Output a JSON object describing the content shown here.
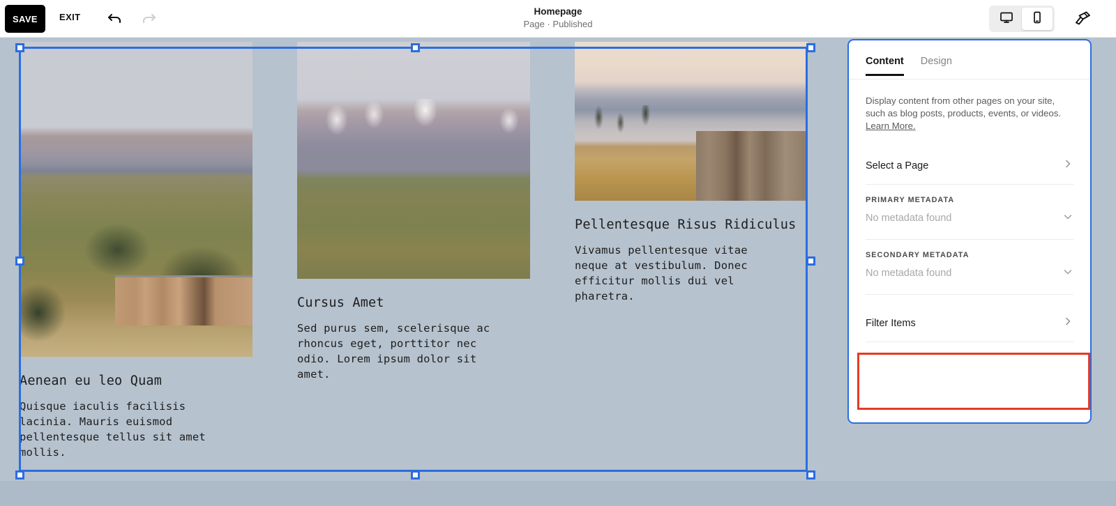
{
  "topbar": {
    "save_label": "SAVE",
    "exit_label": "EXIT",
    "undo_icon": "undo-arrow-icon",
    "redo_icon": "redo-arrow-icon",
    "title": "Homepage",
    "subtitle": "Page · Published",
    "device_desktop_icon": "desktop-monitor-icon",
    "device_mobile_icon": "mobile-phone-icon",
    "device_active": "mobile",
    "brush_icon": "paintbrush-icon"
  },
  "canvas": {
    "background_color": "#b6c2ce",
    "selection_color": "#2b6de0",
    "columns": [
      {
        "image_alt": "mountain-hillside-with-wooden-cabin-photo",
        "title": "Aenean eu leo Quam",
        "body": "Quisque iaculis facilisis\nlacinia. Mauris euismod\npellentesque tellus sit amet\nmollis."
      },
      {
        "image_alt": "snow-capped-mountain-range-photo",
        "title": "Cursus Amet",
        "body": "Sed purus sem, scelerisque ac\nrhoncus eget, porttitor nec\nodio. Lorem ipsum dolor sit\namet."
      },
      {
        "image_alt": "lakeside-cabin-at-dusk-photo",
        "title": "Pellentesque Risus\nRidiculus",
        "body": "Vivamus pellentesque vitae\nneque at vestibulum. Donec\nefficitur mollis dui vel\npharetra."
      }
    ]
  },
  "panel": {
    "border_color": "#2b6de0",
    "tabs": [
      {
        "label": "Content",
        "active": true
      },
      {
        "label": "Design",
        "active": false
      }
    ],
    "description": "Display content from other pages on your site, such as blog posts, products, events, or videos. ",
    "learn_more_label": "Learn More.",
    "select_page_label": "Select a Page",
    "select_page_chevron": "chevron-right-icon",
    "primary_metadata": {
      "label": "PRIMARY METADATA",
      "value": "No metadata found",
      "chevron": "chevron-down-icon"
    },
    "secondary_metadata": {
      "label": "SECONDARY METADATA",
      "value": "No metadata found",
      "chevron": "chevron-down-icon"
    },
    "filter_items": {
      "label": "Filter Items",
      "chevron": "chevron-right-icon",
      "highlight_color": "#e63a21"
    }
  }
}
